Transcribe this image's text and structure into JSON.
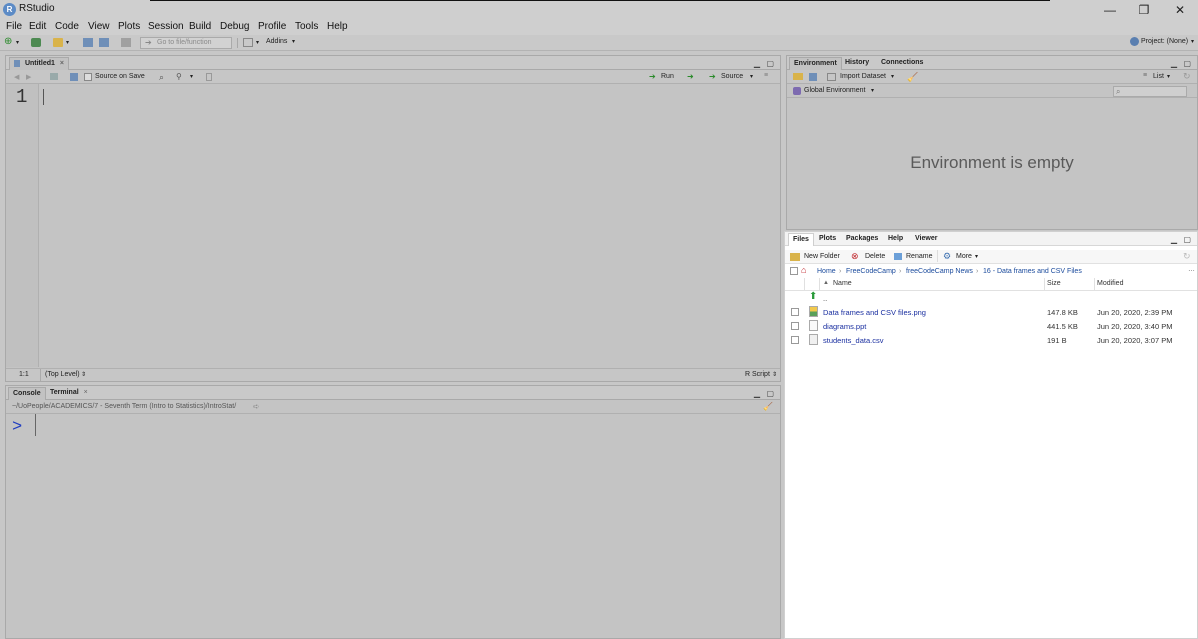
{
  "window": {
    "title": "RStudio",
    "minimize": "—",
    "restore": "❐",
    "close": "✕"
  },
  "menubar": [
    "File",
    "Edit",
    "Code",
    "View",
    "Plots",
    "Session",
    "Build",
    "Debug",
    "Profile",
    "Tools",
    "Help"
  ],
  "toolbar": {
    "goto_placeholder": "Go to file/function",
    "addins": "Addins",
    "project": "Project: (None)"
  },
  "source": {
    "tab": "Untitled1",
    "source_on_save": "Source on Save",
    "run": "Run",
    "source_btn": "Source",
    "line_number": "1",
    "position": "1:1",
    "scope": "(Top Level)",
    "filetype": "R Script"
  },
  "console": {
    "tabs": [
      "Console",
      "Terminal"
    ],
    "path": "~/UoPeople/ACADEMICS/7 - Seventh Term (Intro to Statistics)/IntroStat/",
    "prompt": ">"
  },
  "environment": {
    "tabs": [
      "Environment",
      "History",
      "Connections"
    ],
    "import_dataset": "Import Dataset",
    "list": "List",
    "global_env": "Global Environment",
    "empty_message": "Environment is empty"
  },
  "files": {
    "tabs": [
      "Files",
      "Plots",
      "Packages",
      "Help",
      "Viewer"
    ],
    "new_folder": "New Folder",
    "delete": "Delete",
    "rename": "Rename",
    "more": "More",
    "breadcrumb": [
      "Home",
      "FreeCodeCamp",
      "freeCodeCamp News",
      "16 - Data frames and CSV Files"
    ],
    "columns": {
      "name": "Name",
      "size": "Size",
      "modified": "Modified"
    },
    "parent": "..",
    "rows": [
      {
        "name": "Data frames and CSV files.png",
        "size": "147.8 KB",
        "modified": "Jun 20, 2020, 2:39 PM"
      },
      {
        "name": "diagrams.ppt",
        "size": "441.5 KB",
        "modified": "Jun 20, 2020, 3:40 PM"
      },
      {
        "name": "students_data.csv",
        "size": "191 B",
        "modified": "Jun 20, 2020, 3:07 PM"
      }
    ]
  }
}
